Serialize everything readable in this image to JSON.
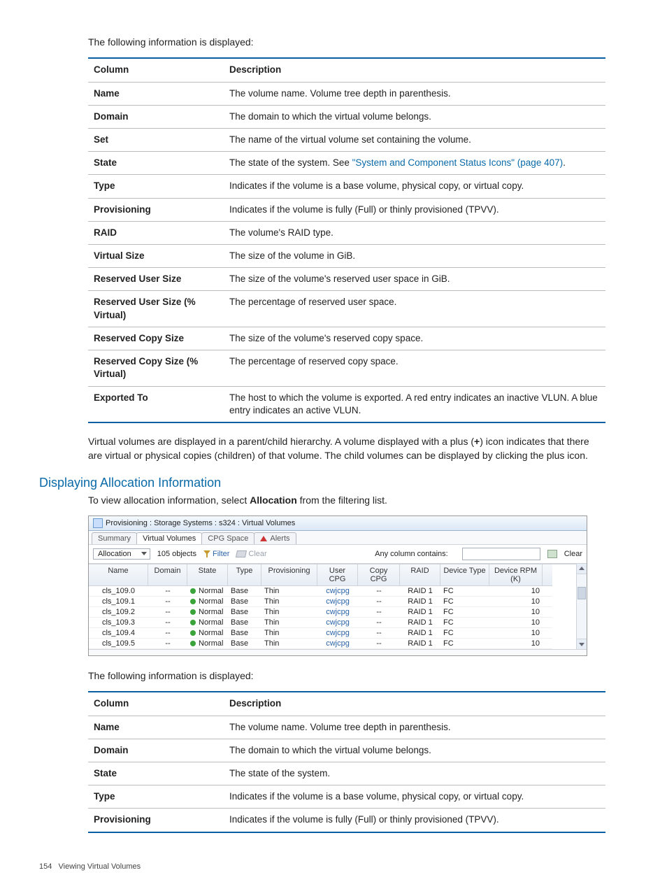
{
  "intro1": "The following information is displayed:",
  "tbl1_head": {
    "c1": "Column",
    "c2": "Description"
  },
  "tbl1": [
    {
      "c": "Name",
      "d": "The volume name. Volume tree depth in parenthesis."
    },
    {
      "c": "Domain",
      "d": "The domain to which the virtual volume belongs."
    },
    {
      "c": "Set",
      "d": "The name of the virtual volume set containing the volume."
    },
    {
      "c": "State",
      "d_pre": "The state of the system. See ",
      "d_link": "\"System and Component Status Icons\" (page 407)",
      "d_post": "."
    },
    {
      "c": "Type",
      "d": "Indicates if the volume is a base volume, physical copy, or virtual copy."
    },
    {
      "c": "Provisioning",
      "d": "Indicates if the volume is fully (Full) or thinly provisioned (TPVV)."
    },
    {
      "c": "RAID",
      "d": "The volume's RAID type."
    },
    {
      "c": "Virtual Size",
      "d": "The size of the volume in GiB."
    },
    {
      "c": "Reserved User Size",
      "d": "The size of the volume's reserved user space in GiB."
    },
    {
      "c": "Reserved User Size (% Virtual)",
      "d": "The percentage of reserved user space."
    },
    {
      "c": "Reserved Copy Size",
      "d": "The size of the volume's reserved copy space."
    },
    {
      "c": "Reserved Copy Size (% Virtual)",
      "d": "The percentage of reserved copy space."
    },
    {
      "c": "Exported To",
      "d": "The host to which the volume is exported. A red entry indicates an inactive VLUN. A blue entry indicates an active VLUN."
    }
  ],
  "para_hierarchy_pre": "Virtual volumes are displayed in a parent/child hierarchy. A volume displayed with a plus (",
  "para_hierarchy_bold": "+",
  "para_hierarchy_post": ") icon indicates that there are virtual or physical copies (children) of that volume. The child volumes can be displayed by clicking the plus icon.",
  "section_title": "Displaying Allocation Information",
  "para_alloc_pre": "To view allocation information, select ",
  "para_alloc_bold": "Allocation",
  "para_alloc_post": " from the filtering list.",
  "shot": {
    "title": "Provisioning : Storage Systems : s324 : Virtual Volumes",
    "tabs": [
      "Summary",
      "Virtual Volumes",
      "CPG Space",
      "Alerts"
    ],
    "combo": "Allocation",
    "objects": "105 objects",
    "filter": "Filter",
    "clear": "Clear",
    "anycol": "Any column contains:",
    "clear2": "Clear",
    "headers": [
      "Name",
      "Domain",
      "State",
      "Type",
      "Provisioning",
      "User CPG",
      "Copy CPG",
      "RAID",
      "Device Type",
      "Device RPM (K)"
    ],
    "rows": [
      {
        "n": "cls_109.0",
        "dom": "--",
        "st": "Normal",
        "ty": "Base",
        "pv": "Thin",
        "uc": "cwjcpg",
        "cc": "--",
        "rd": "RAID 1",
        "dt": "FC",
        "rpm": "10"
      },
      {
        "n": "cls_109.1",
        "dom": "--",
        "st": "Normal",
        "ty": "Base",
        "pv": "Thin",
        "uc": "cwjcpg",
        "cc": "--",
        "rd": "RAID 1",
        "dt": "FC",
        "rpm": "10"
      },
      {
        "n": "cls_109.2",
        "dom": "--",
        "st": "Normal",
        "ty": "Base",
        "pv": "Thin",
        "uc": "cwjcpg",
        "cc": "--",
        "rd": "RAID 1",
        "dt": "FC",
        "rpm": "10"
      },
      {
        "n": "cls_109.3",
        "dom": "--",
        "st": "Normal",
        "ty": "Base",
        "pv": "Thin",
        "uc": "cwjcpg",
        "cc": "--",
        "rd": "RAID 1",
        "dt": "FC",
        "rpm": "10"
      },
      {
        "n": "cls_109.4",
        "dom": "--",
        "st": "Normal",
        "ty": "Base",
        "pv": "Thin",
        "uc": "cwjcpg",
        "cc": "--",
        "rd": "RAID 1",
        "dt": "FC",
        "rpm": "10"
      },
      {
        "n": "cls_109.5",
        "dom": "--",
        "st": "Normal",
        "ty": "Base",
        "pv": "Thin",
        "uc": "cwjcpg",
        "cc": "--",
        "rd": "RAID 1",
        "dt": "FC",
        "rpm": "10"
      }
    ]
  },
  "intro2": "The following information is displayed:",
  "tbl2_head": {
    "c1": "Column",
    "c2": "Description"
  },
  "tbl2": [
    {
      "c": "Name",
      "d": "The volume name. Volume tree depth in parenthesis."
    },
    {
      "c": "Domain",
      "d": "The domain to which the virtual volume belongs."
    },
    {
      "c": "State",
      "d": "The state of the system."
    },
    {
      "c": "Type",
      "d": "Indicates if the volume is a base volume, physical copy, or virtual copy."
    },
    {
      "c": "Provisioning",
      "d": "Indicates if the volume is fully (Full) or thinly provisioned (TPVV)."
    }
  ],
  "footer_num": "154",
  "footer_txt": "Viewing Virtual Volumes"
}
